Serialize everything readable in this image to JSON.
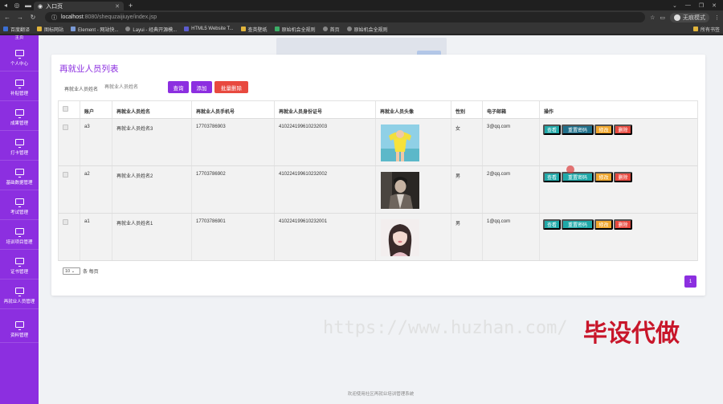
{
  "browser": {
    "tab_title": "入口页",
    "url_host": "localhost",
    "url_rest": ":8080/shequzaijiuye/index.jsp",
    "profile_name": "无痕模式",
    "bookmarks": [
      "百度翻译",
      "图标网站",
      "Element - 网站快...",
      "Layui - 经典开源模...",
      "HTML5 Website T...",
      "查英壁纸",
      "原始机会全规则",
      "首页",
      "原始机会全规则"
    ],
    "bookmarks_right": "所有书签"
  },
  "sidebar": {
    "partial_label": "主页",
    "items": [
      {
        "label": "个人中心"
      },
      {
        "label": "补贴管理"
      },
      {
        "label": "成果管理"
      },
      {
        "label": "打卡管理"
      },
      {
        "label": "基础数据管理"
      },
      {
        "label": "考试管理"
      },
      {
        "label": "培训项目管理"
      },
      {
        "label": "证书管理"
      },
      {
        "label": "再就业人员管理"
      },
      {
        "label": "资料管理"
      }
    ]
  },
  "main": {
    "title": "再就业人员列表",
    "search_label": "再就业人员姓名",
    "search_placeholder": "再就业人员姓名",
    "btn_query": "查询",
    "btn_add": "添加",
    "btn_batch_delete": "批量删除",
    "columns": [
      "账户",
      "再就业人员姓名",
      "再就业人员手机号",
      "再就业人员身份证号",
      "再就业人员头像",
      "性别",
      "电子邮箱",
      "操作"
    ],
    "rows": [
      {
        "account": "a3",
        "name": "再就业人员姓名3",
        "phone": "17703786903",
        "idcard": "410224199610232003",
        "gender": "女",
        "email": "3@qq.com"
      },
      {
        "account": "a2",
        "name": "再就业人员姓名2",
        "phone": "17703786902",
        "idcard": "410224199610232002",
        "gender": "男",
        "email": "2@qq.com"
      },
      {
        "account": "a1",
        "name": "再就业人员姓名1",
        "phone": "17703786901",
        "idcard": "410224199610232001",
        "gender": "男",
        "email": "1@qq.com"
      }
    ],
    "actions": {
      "view": "查看",
      "reset": "重置密码",
      "edit": "修改",
      "delete": "删除"
    },
    "page_size": "10",
    "page_size_suffix": "条 每页",
    "current_page": "1"
  },
  "footer": "欢迎使用社区再就业培训管理系统",
  "watermark": {
    "url": "https://www.huzhan.com/",
    "brand": "毕设代做"
  },
  "colors": {
    "accent": "#8c2fe0",
    "danger": "#e8493f",
    "teal": "#1fa8a8",
    "warning": "#f0a72e"
  }
}
